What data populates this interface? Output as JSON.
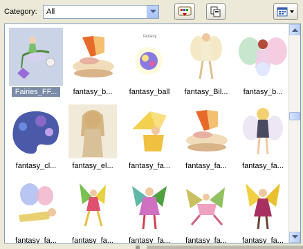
{
  "category": {
    "label": "Category:",
    "value": "All"
  },
  "toolbar": {
    "buttons": [
      {
        "name": "download-clipart-button",
        "icon": "palette-download-icon"
      },
      {
        "name": "copy-button",
        "icon": "copy-icon"
      },
      {
        "name": "view-options-button",
        "icon": "view-grid-icon"
      }
    ]
  },
  "gallery": {
    "selected_index": 0,
    "items": [
      {
        "label": "Fairies_FF...",
        "icon": "fairy-on-flower-icon"
      },
      {
        "label": "fantasy_b...",
        "icon": "sleeping-fairy-on-cloud-icon"
      },
      {
        "label": "fantasy_ball",
        "icon": "crystal-ball-icon"
      },
      {
        "label": "fantasy_Bil...",
        "icon": "fairy-with-wings-icon"
      },
      {
        "label": "fantasy_b...",
        "icon": "fairy-with-orb-icon"
      },
      {
        "label": "fantasy_cl...",
        "icon": "palette-fairies-icon"
      },
      {
        "label": "fantasy_el...",
        "icon": "elf-fairy-portrait-icon"
      },
      {
        "label": "fantasy_fa...",
        "icon": "yellow-fairy-icon"
      },
      {
        "label": "fantasy_fa...",
        "icon": "sleeping-fairy-on-cloud-icon"
      },
      {
        "label": "fantasy_fa...",
        "icon": "blonde-fairy-icon"
      },
      {
        "label": "fantasy_fa...",
        "icon": "flying-fairy-icon"
      },
      {
        "label": "fantasy_fa...",
        "icon": "dancing-fairy-icon"
      },
      {
        "label": "fantasy_fa...",
        "icon": "green-winged-fairy-icon"
      },
      {
        "label": "fantasy_fa...",
        "icon": "pink-fairy-icon"
      },
      {
        "label": "fantasy_fa...",
        "icon": "yellow-winged-fairy-icon"
      }
    ]
  }
}
